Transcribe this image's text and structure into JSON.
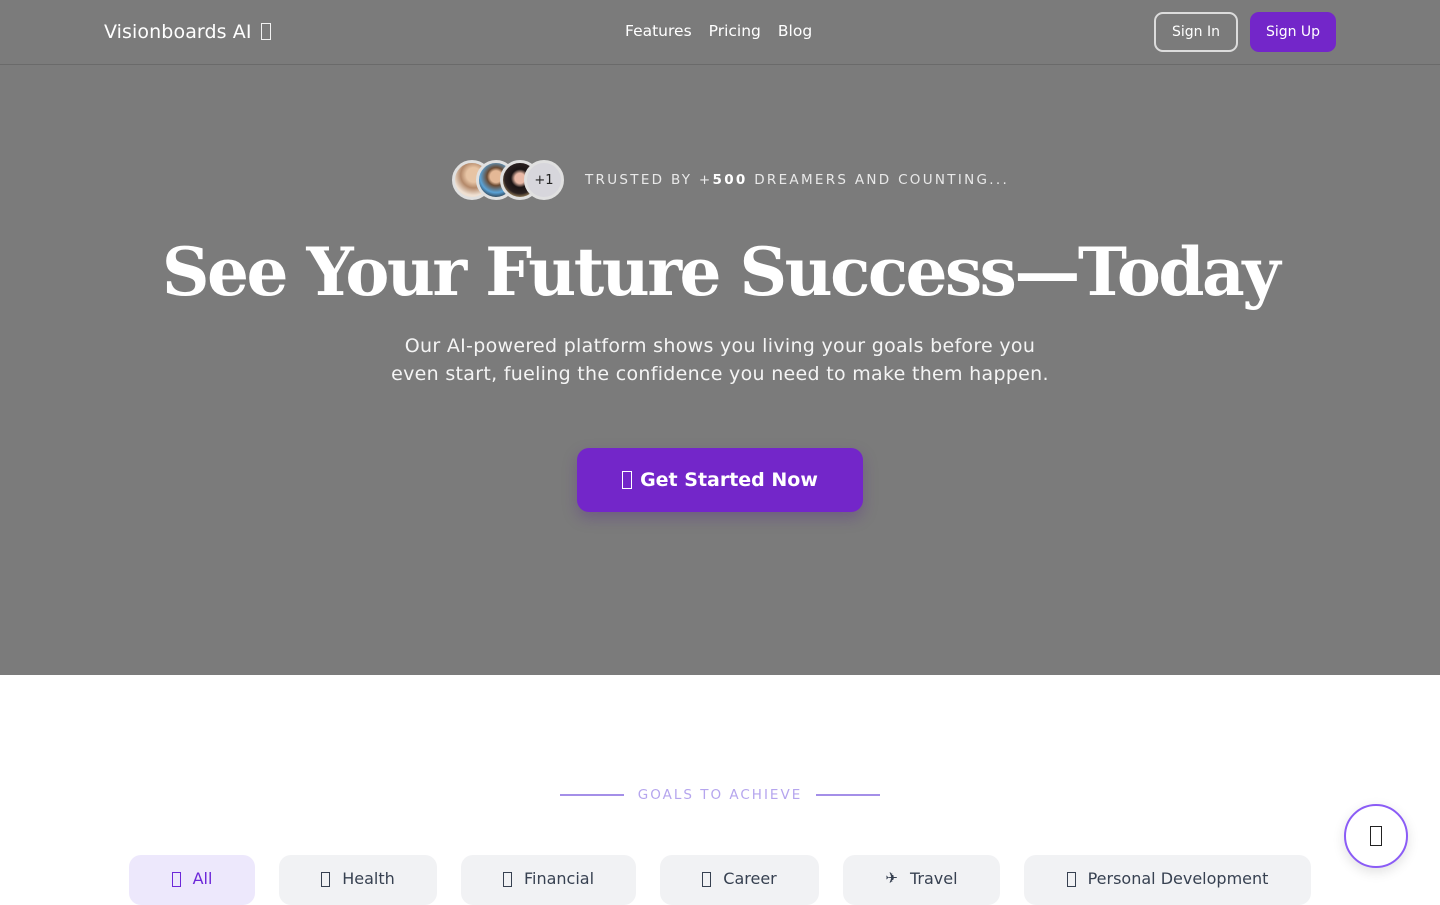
{
  "header": {
    "brand": "Visionboards AI",
    "brand_icon": "sparkle-icon",
    "nav": [
      {
        "label": "Features"
      },
      {
        "label": "Pricing"
      },
      {
        "label": "Blog"
      }
    ],
    "sign_in_label": "Sign In",
    "sign_up_label": "Sign Up"
  },
  "hero": {
    "trust": {
      "avatars": [
        "user-avatar-1",
        "user-avatar-2",
        "user-avatar-3"
      ],
      "more_count": "+1",
      "prefix": "TRUSTED BY +",
      "count": "500",
      "suffix": " DREAMERS AND COUNTING..."
    },
    "headline": "See Your Future Success—Today",
    "subtext": "Our AI-powered platform shows you living your goals before you even start, fueling the confidence you need to make them happen.",
    "cta_label": "Get Started Now",
    "cta_icon": "rocket-icon"
  },
  "goals": {
    "section_label": "GOALS TO ACHIEVE",
    "tabs": [
      {
        "label": "All",
        "icon": "sparkle-icon",
        "active": true
      },
      {
        "label": "Health",
        "icon": "health-icon",
        "active": false
      },
      {
        "label": "Financial",
        "icon": "money-icon",
        "active": false
      },
      {
        "label": "Career",
        "icon": "briefcase-icon",
        "active": false
      },
      {
        "label": "Travel",
        "icon": "airplane-icon",
        "active": false
      },
      {
        "label": "Personal Development",
        "icon": "growth-icon",
        "active": false
      }
    ]
  },
  "fab": {
    "icon": "chat-icon"
  },
  "colors": {
    "brand_purple": "#7326c9",
    "hero_overlay": "#7b7b7b",
    "accent_light": "#ede8fc",
    "section_label": "#b5a5ee"
  }
}
